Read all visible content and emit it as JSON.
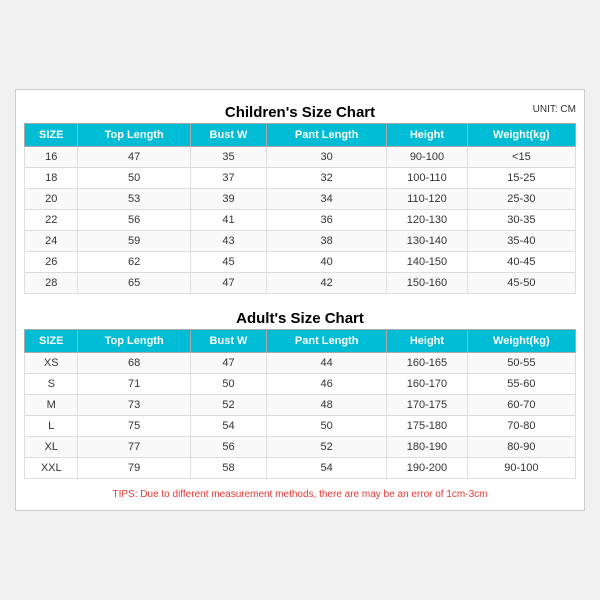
{
  "children_title": "Children's Size Chart",
  "adult_title": "Adult's Size Chart",
  "unit": "UNIT: CM",
  "headers": [
    "SIZE",
    "Top Length",
    "Bust W",
    "Pant Length",
    "Height",
    "Weight(kg)"
  ],
  "children_rows": [
    [
      "16",
      "47",
      "35",
      "30",
      "90-100",
      "<15"
    ],
    [
      "18",
      "50",
      "37",
      "32",
      "100-110",
      "15-25"
    ],
    [
      "20",
      "53",
      "39",
      "34",
      "110-120",
      "25-30"
    ],
    [
      "22",
      "56",
      "41",
      "36",
      "120-130",
      "30-35"
    ],
    [
      "24",
      "59",
      "43",
      "38",
      "130-140",
      "35-40"
    ],
    [
      "26",
      "62",
      "45",
      "40",
      "140-150",
      "40-45"
    ],
    [
      "28",
      "65",
      "47",
      "42",
      "150-160",
      "45-50"
    ]
  ],
  "adult_rows": [
    [
      "XS",
      "68",
      "47",
      "44",
      "160-165",
      "50-55"
    ],
    [
      "S",
      "71",
      "50",
      "46",
      "160-170",
      "55-60"
    ],
    [
      "M",
      "73",
      "52",
      "48",
      "170-175",
      "60-70"
    ],
    [
      "L",
      "75",
      "54",
      "50",
      "175-180",
      "70-80"
    ],
    [
      "XL",
      "77",
      "56",
      "52",
      "180-190",
      "80-90"
    ],
    [
      "XXL",
      "79",
      "58",
      "54",
      "190-200",
      "90-100"
    ]
  ],
  "tips": "TIPS: Due to different measurement methods, there are may be an error of 1cm-3cm"
}
